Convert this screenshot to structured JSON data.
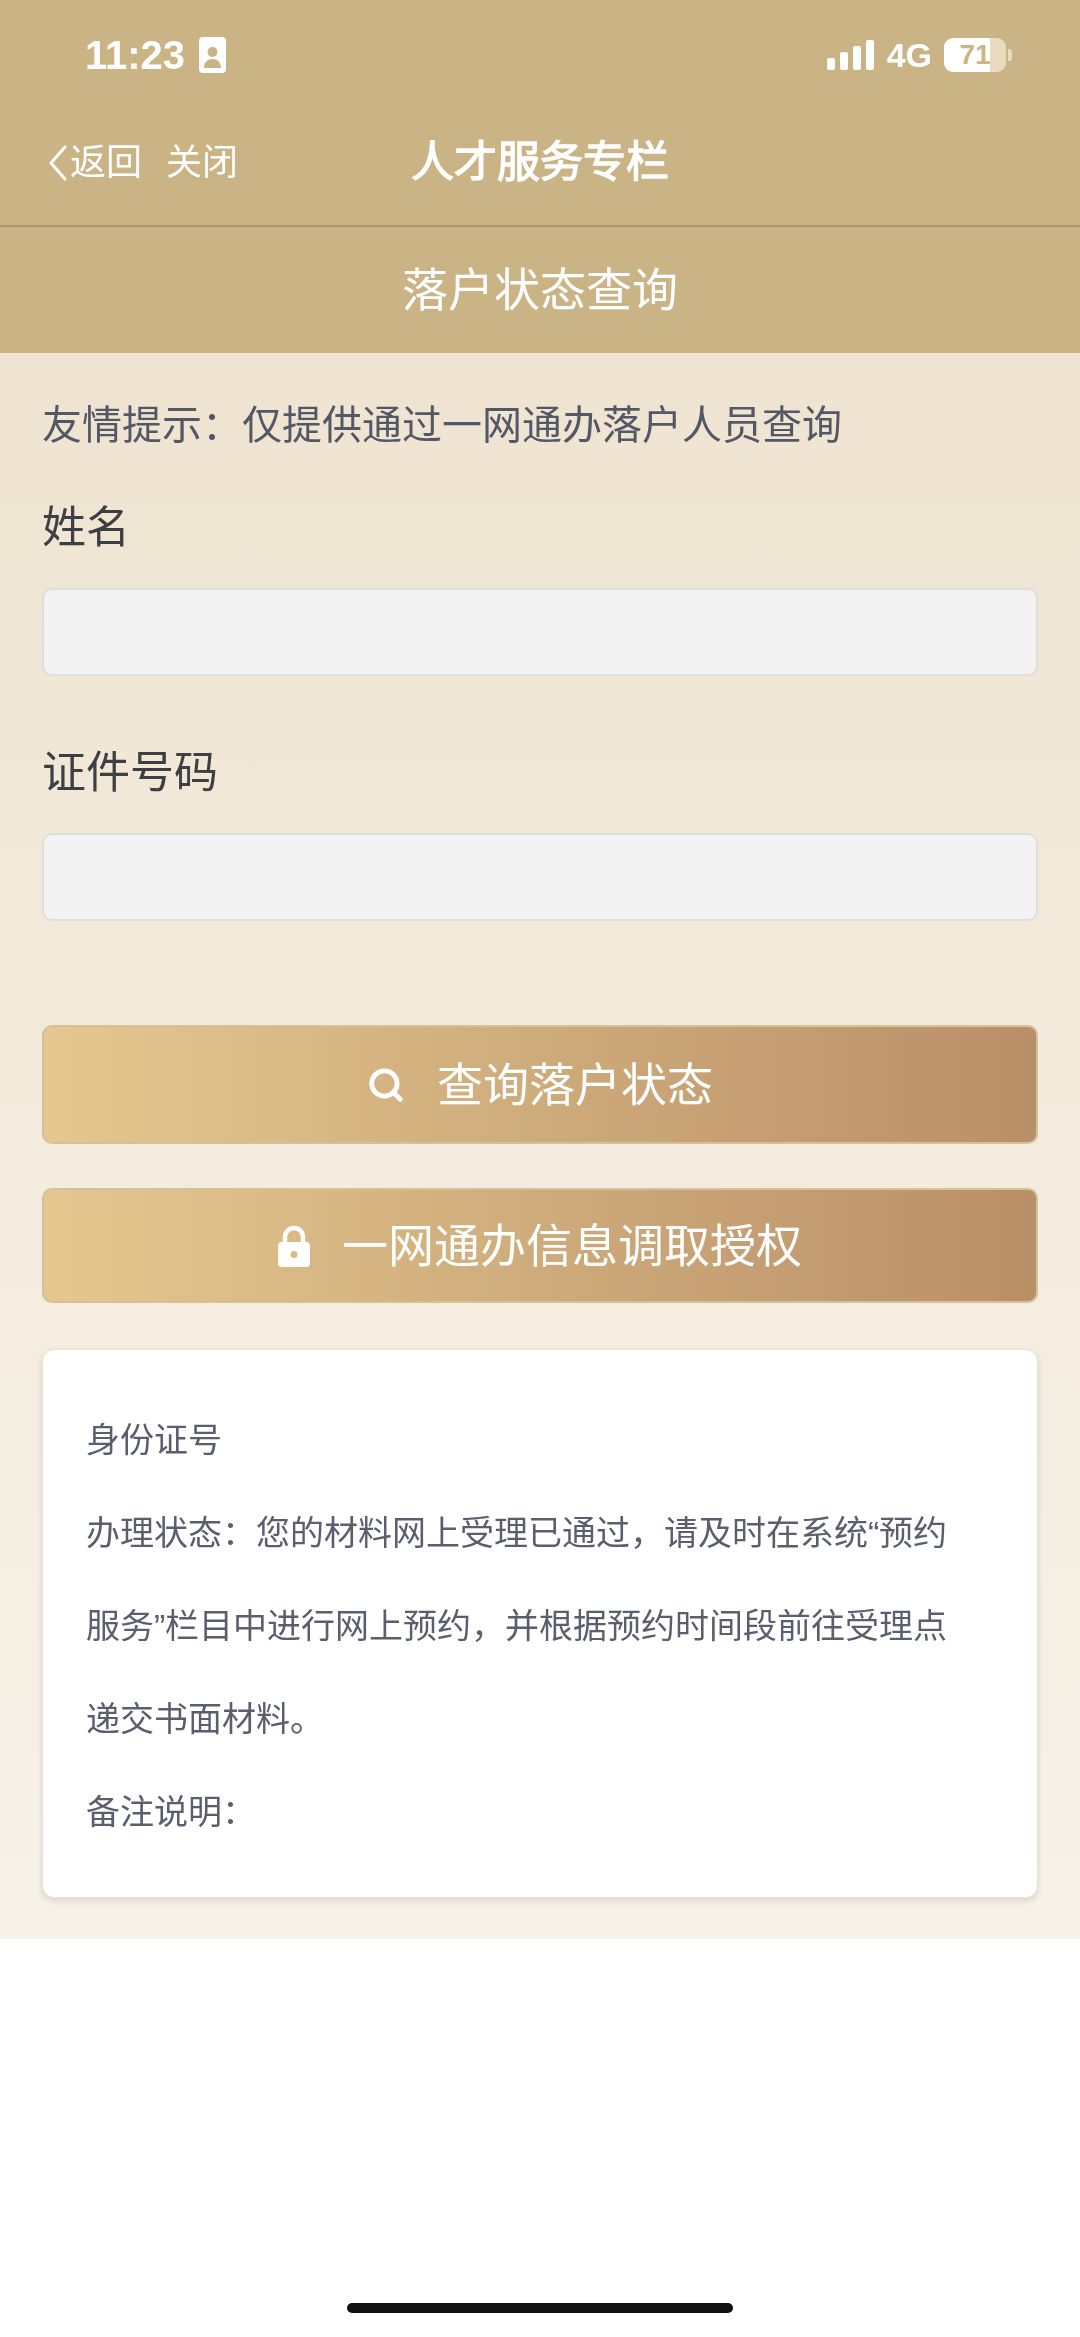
{
  "status_bar": {
    "time": "11:23",
    "network": "4G",
    "battery": "71"
  },
  "nav_bar": {
    "back": "返回",
    "close": "关闭",
    "title": "人才服务专栏"
  },
  "page_header": {
    "title": "落户状态查询"
  },
  "form": {
    "notice": "友情提示：仅提供通过一网通办落户人员查询",
    "fields": [
      {
        "label": "姓名"
      },
      {
        "label": "证件号码"
      }
    ],
    "buttons": [
      {
        "kind": "search",
        "label": "查询落户状态"
      },
      {
        "kind": "lock",
        "label": "一网通办信息调取授权"
      }
    ]
  },
  "result": {
    "rows": [
      {
        "label": "身份证号"
      },
      {
        "label": "办理状态：",
        "value": "您的材料网上受理已通过，请及时在系统“预约服务”栏目中进行网上预约，并根据预约时间段前往受理点递交书面材料。"
      },
      {
        "label": "备注说明："
      }
    ]
  }
}
